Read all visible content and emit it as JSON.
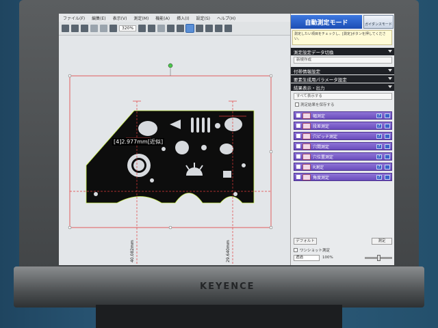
{
  "app": {
    "menu": [
      "ファイル(F)",
      "編集(E)",
      "表示(V)",
      "測定(M)",
      "機能(A)",
      "挿入(I)",
      "設定(S)",
      "ヘルプ(H)"
    ],
    "zoom": "320%"
  },
  "panel": {
    "mode_title": "自動測定モード",
    "guide_label": "ガイダンスモード",
    "hint": "測定したい項目をチェックし、[測定]ボタンを押してください。",
    "sections": {
      "data_switch": "測定設定データ切換",
      "data_value": "新規作成",
      "info": "付帯情報設定",
      "element_params": "要素生成用パラメータ設定",
      "result_output": "結果表示・出力",
      "result_value": "すべて表示する",
      "save_result": "測定結果を保存する"
    },
    "measurements": [
      {
        "label": "幅測定",
        "checked": true
      },
      {
        "label": "段差測定",
        "checked": true
      },
      {
        "label": "穴ピッチ測定",
        "checked": true
      },
      {
        "label": "穴間測定",
        "checked": false
      },
      {
        "label": "穴位置測定",
        "checked": false
      },
      {
        "label": "R測定",
        "checked": false
      },
      {
        "label": "角度測定",
        "checked": false
      }
    ],
    "default_button": "デフォルト",
    "measure_button": "測定",
    "status_check": "ワンショット測定",
    "bottom_select": "透過",
    "bottom_percent": "100%"
  },
  "canvas": {
    "measure_label": "[4]2.977mm[近似]",
    "v_label_1": "40.082mm",
    "v_label_2": "29.640mm"
  },
  "brand": "KEYENCE",
  "colors": {
    "accent": "#2a5fa8",
    "measure_row": "#6a4cbc",
    "section_bar": "#1f2126",
    "part_fill": "#0d0d0d",
    "guide_red": "#e23a3a"
  }
}
